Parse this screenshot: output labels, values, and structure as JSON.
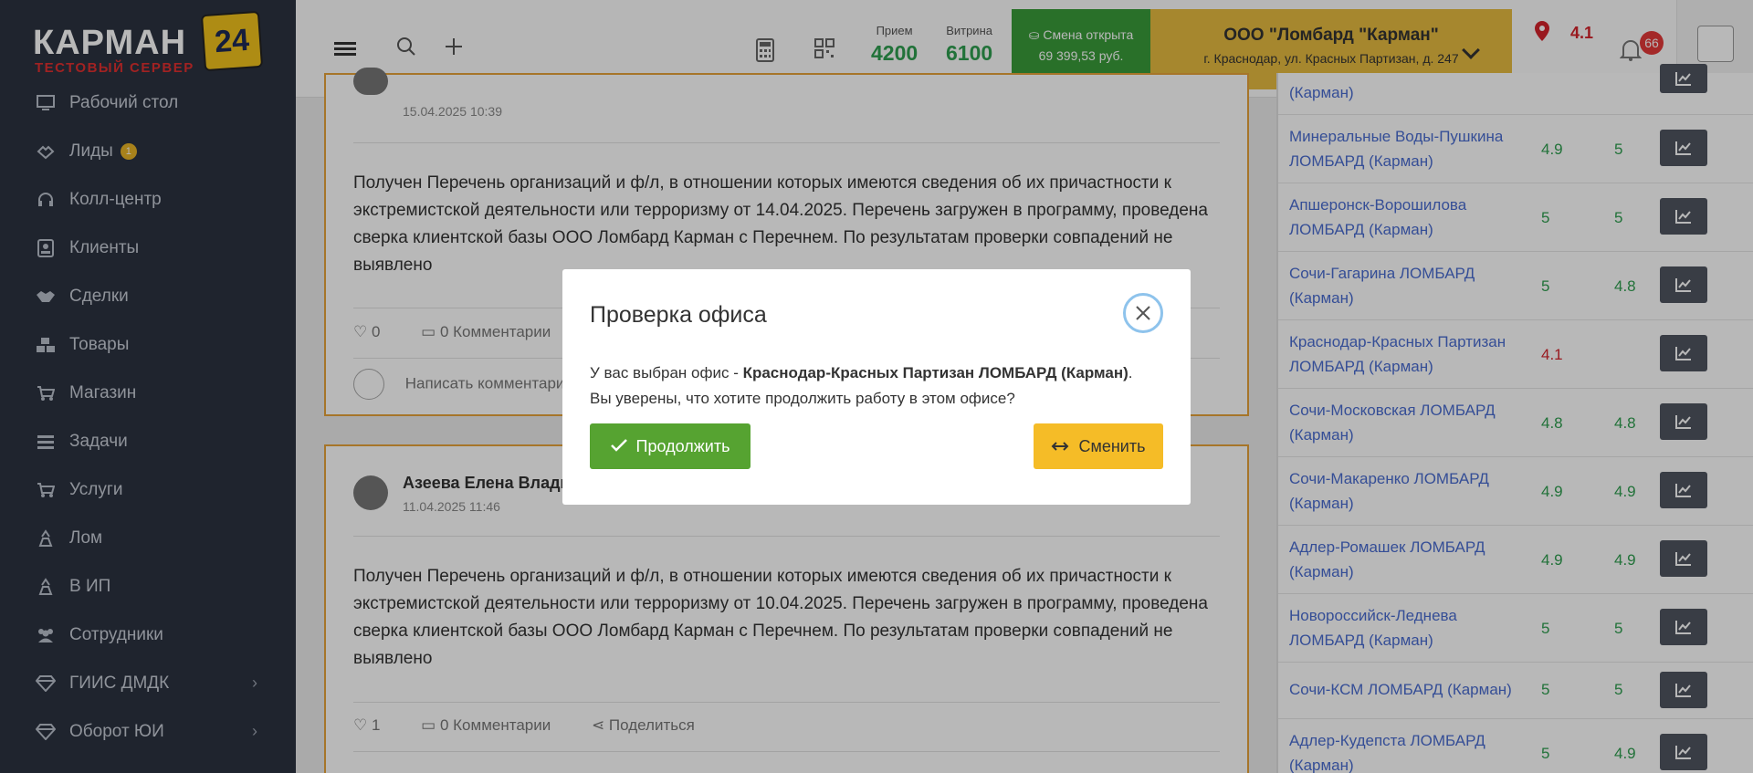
{
  "logo": {
    "brand": "КАРМАН",
    "badge": "24",
    "subtitle": "ТЕСТОВЫЙ СЕРВЕР"
  },
  "sidebar": {
    "items": [
      {
        "label": "Рабочий стол",
        "icon": "desktop-icon"
      },
      {
        "label": "Лиды",
        "icon": "handshake-outline-icon",
        "badge": "1"
      },
      {
        "label": "Колл-центр",
        "icon": "headset-icon"
      },
      {
        "label": "Клиенты",
        "icon": "contact-card-icon"
      },
      {
        "label": "Сделки",
        "icon": "handshake-icon"
      },
      {
        "label": "Товары",
        "icon": "boxes-icon"
      },
      {
        "label": "Магазин",
        "icon": "cart-icon"
      },
      {
        "label": "Задачи",
        "icon": "tasks-icon"
      },
      {
        "label": "Услуги",
        "icon": "cart-icon"
      },
      {
        "label": "Лом",
        "icon": "scrap-icon"
      },
      {
        "label": "В ИП",
        "icon": "scrap-icon"
      },
      {
        "label": "Сотрудники",
        "icon": "users-icon"
      },
      {
        "label": "ГИИС ДМДК",
        "icon": "diamond-icon",
        "chevron": "›"
      },
      {
        "label": "Оборот ЮИ",
        "icon": "diamond-icon",
        "chevron": "›"
      }
    ]
  },
  "header": {
    "stats": [
      {
        "label": "Прием",
        "value": "4200"
      },
      {
        "label": "Витрина",
        "value": "6100"
      }
    ],
    "shift": {
      "title": "Смена открыта",
      "amount": "69 399,53 руб."
    },
    "org": {
      "name": "ООО \"Ломбард \"Карман\"",
      "address": "г. Краснодар, ул. Красных Партизан, д. 247"
    },
    "rating": "4.1",
    "notifications": "66"
  },
  "posts": [
    {
      "date": "15.04.2025 10:39",
      "text": "Получен Перечень организаций и ф/л, в отношении которых имеются сведения об их причастности к экстремистской деятельности или терроризму от 14.04.2025. Перечень загружен в программу, проведена сверка клиентской базы ООО Ломбард Карман с Перечнем. По результатам проверки совпадений не выявлено",
      "likes": "0",
      "comments": "0 Комментарии",
      "comment_placeholder": "Написать комментарий"
    },
    {
      "author": "Азеева Елена Владимировна",
      "date": "11.04.2025 11:46",
      "text": "Получен Перечень организаций и ф/л, в отношении которых имеются сведения об их причастности к экстремистской деятельности или терроризму от 10.04.2025. Перечень загружен в программу, проведена сверка клиентской базы ООО Ломбард Карман с Перечнем. По результатам проверки совпадений не выявлено",
      "likes": "1",
      "comments": "0 Комментарии",
      "share": "Поделиться"
    }
  ],
  "offices": [
    {
      "name": "(Карман)",
      "v1": "",
      "v2": ""
    },
    {
      "name": "Минеральные Воды-Пушкина ЛОМБАРД (Карман)",
      "v1": "4.9",
      "v2": "5"
    },
    {
      "name": "Апшеронск-Ворошилова ЛОМБАРД (Карман)",
      "v1": "5",
      "v2": "5"
    },
    {
      "name": "Сочи-Гагарина ЛОМБАРД (Карман)",
      "v1": "5",
      "v2": "4.8"
    },
    {
      "name": "Краснодар-Красных Партизан ЛОМБАРД (Карман)",
      "v1": "4.1",
      "v2": "",
      "v1_color": "#d4232b"
    },
    {
      "name": "Сочи-Московская ЛОМБАРД (Карман)",
      "v1": "4.8",
      "v2": "4.8"
    },
    {
      "name": "Сочи-Макаренко ЛОМБАРД (Карман)",
      "v1": "4.9",
      "v2": "4.9"
    },
    {
      "name": "Адлер-Ромашек ЛОМБАРД (Карман)",
      "v1": "4.9",
      "v2": "4.9"
    },
    {
      "name": "Новороссийск-Леднева ЛОМБАРД (Карман)",
      "v1": "5",
      "v2": "5"
    },
    {
      "name": "Сочи-КСМ ЛОМБАРД (Карман)",
      "v1": "5",
      "v2": "5"
    },
    {
      "name": "Адлер-Кудепста ЛОМБАРД (Карман)",
      "v1": "5",
      "v2": "4.9"
    }
  ],
  "modal": {
    "title": "Проверка офиса",
    "text_prefix": "У вас выбран офис - ",
    "office": "Краснодар-Красных Партизан ЛОМБАРД (Карман)",
    "text_suffix": ".",
    "question": "Вы уверены, что хотите продолжить работу в этом офисе?",
    "continue_label": "Продолжить",
    "change_label": "Сменить"
  },
  "colors": {
    "sidebar_bg": "#2c3240",
    "accent_green": "#56a331",
    "accent_yellow": "#f5bc27",
    "link_blue": "#4a6cd0",
    "post_border": "#e7a33a"
  }
}
